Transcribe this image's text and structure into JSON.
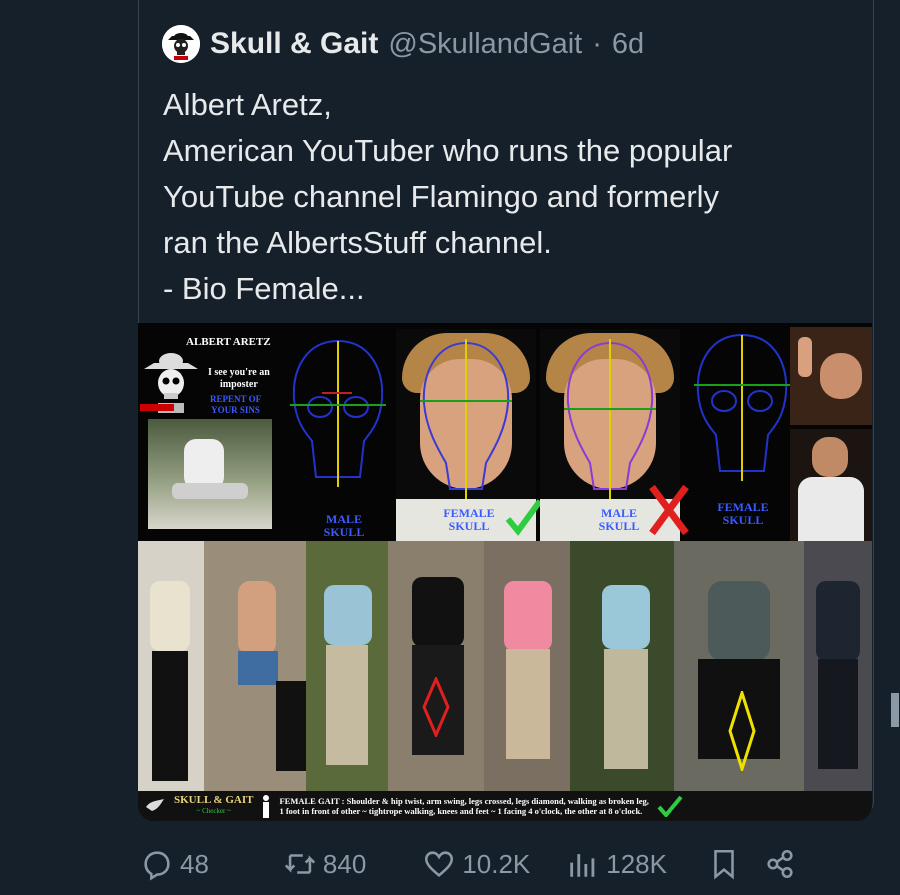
{
  "tweet": {
    "author_name": "Skull & Gait",
    "handle": "@SkullandGait",
    "separator": "·",
    "time": "6d",
    "text_lines": [
      "Albert Aretz,",
      "American YouTuber who runs the popular",
      "YouTube channel Flamingo and formerly",
      "ran the AlbertsStuff channel.",
      "- Bio Female..."
    ]
  },
  "media": {
    "title": "ALBERT ARETZ",
    "taunt_lines": [
      "I see you're an",
      "imposter"
    ],
    "repent_lines": [
      "REPENT OF",
      "YOUR SINS"
    ],
    "skull_labels": {
      "male_left": "MALE SKULL",
      "female_center": "FEMALE SKULL",
      "male_center": "MALE SKULL",
      "female_right": "FEMALE SKULL"
    },
    "brand": "SKULL & GAIT",
    "brand_sub": "~ Checker ~",
    "gait_caption_line1": "FEMALE GAIT : Shoulder & hip twist, arm swing, legs crossed, legs diamond, walking as broken leg,",
    "gait_caption_line2": "1 foot in front of other ~ tightrope walking, knees and feet ~ 1 facing 4 o'clock, the other at 8 o'clock."
  },
  "actions": {
    "replies": "48",
    "retweets": "840",
    "likes": "10.2K",
    "views": "128K"
  },
  "icons": [
    "skull-avatar-icon",
    "reply-icon",
    "retweet-icon",
    "like-icon",
    "views-icon",
    "bookmark-icon",
    "share-icon"
  ],
  "colors": {
    "background": "#15202b",
    "text": "#e7e9ea",
    "muted": "#8b98a5",
    "check": "#2ecc40",
    "cross": "#e0201e"
  }
}
